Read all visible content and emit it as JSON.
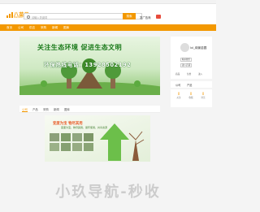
{
  "topbar": {
    "links": [
      "",
      "",
      "",
      ""
    ]
  },
  "header": {
    "logo_main": "八苗易",
    "logo_sub": "BAMIAOYI",
    "search_placeholder": "请输入关键词",
    "search_scope": "供应",
    "search_button": "搜索",
    "publish_label": "发广告商"
  },
  "nav": {
    "items": [
      "首页",
      "公司",
      "供应",
      "采购",
      "新闻",
      "图库"
    ]
  },
  "banner": {
    "title": "关注生态环境 促进生态文明",
    "phone": "环保热线电话：13928502192"
  },
  "seller": {
    "name": "lxl_绿景苗圃",
    "buttons": [
      "联系我们",
      "进入店铺"
    ],
    "links": [
      "商品",
      "信誉",
      "进入"
    ]
  },
  "mini_tabs": [
    "公司",
    "产品"
  ],
  "stats": [
    {
      "value": "0",
      "label": "关注"
    },
    {
      "value": "0",
      "label": "收藏"
    },
    {
      "value": "0",
      "label": "浏览"
    }
  ],
  "content_tabs": [
    "公司",
    "产品",
    "采购",
    "新闻",
    "图库"
  ],
  "poster": {
    "title": "变废为宝 物尽其用",
    "subtitle": "变废为宝，物尽其用，循环使用，共享资源"
  },
  "watermark": "小玖导航-秒收",
  "colors": {
    "accent": "#f39800",
    "banner_green": "#1a7a1a"
  }
}
